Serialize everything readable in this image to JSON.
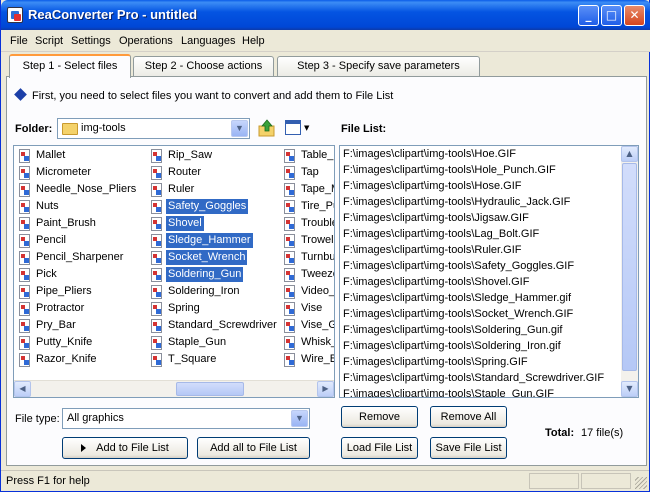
{
  "window": {
    "title": "ReaConverter Pro - untitled",
    "minimize": "_",
    "maximize": "□",
    "close": "✕"
  },
  "menu": [
    "File",
    "Script",
    "Settings",
    "Operations",
    "Languages",
    "Help"
  ],
  "tabs": [
    {
      "label": "Step 1 - Select files",
      "active": true
    },
    {
      "label": "Step 2 - Choose actions",
      "active": false
    },
    {
      "label": "Step 3 - Specify save parameters",
      "active": false
    }
  ],
  "hint": "First, you need to select files you want to convert and add them to File List",
  "folder": {
    "label": "Folder:",
    "value": "img-tools"
  },
  "file_list_label": "File List:",
  "files": {
    "col1": [
      "Mallet",
      "Micrometer",
      "Needle_Nose_Pliers",
      "Nuts",
      "Paint_Brush",
      "Pencil",
      "Pencil_Sharpener",
      "Pick",
      "Pipe_Pliers",
      "Protractor",
      "Pry_Bar",
      "Putty_Knife",
      "Razor_Knife"
    ],
    "col2": [
      "Rip_Saw",
      "Router",
      "Ruler",
      "Safety_Goggles",
      "Shovel",
      "Sledge_Hammer",
      "Socket_Wrench",
      "Soldering_Gun",
      "Soldering_Iron",
      "Spring",
      "Standard_Screwdriver",
      "Staple_Gun",
      "T_Square"
    ],
    "col3": [
      "Table_",
      "Tap",
      "Tape_M",
      "Tire_Pu",
      "Trouble",
      "Trowel",
      "Turnbu",
      "Tweeze",
      "Video_",
      "Vise",
      "Vise_G",
      "Whisk_",
      "Wire_B"
    ],
    "selected": [
      "Safety_Goggles",
      "Shovel",
      "Sledge_Hammer",
      "Socket_Wrench",
      "Soldering_Gun"
    ]
  },
  "file_list": [
    "F:\\images\\clipart\\img-tools\\Hoe.GIF",
    "F:\\images\\clipart\\img-tools\\Hole_Punch.GIF",
    "F:\\images\\clipart\\img-tools\\Hose.GIF",
    "F:\\images\\clipart\\img-tools\\Hydraulic_Jack.GIF",
    "F:\\images\\clipart\\img-tools\\Jigsaw.GIF",
    "F:\\images\\clipart\\img-tools\\Lag_Bolt.GIF",
    "F:\\images\\clipart\\img-tools\\Ruler.GIF",
    "F:\\images\\clipart\\img-tools\\Safety_Goggles.GIF",
    "F:\\images\\clipart\\img-tools\\Shovel.GIF",
    "F:\\images\\clipart\\img-tools\\Sledge_Hammer.gif",
    "F:\\images\\clipart\\img-tools\\Socket_Wrench.GIF",
    "F:\\images\\clipart\\img-tools\\Soldering_Gun.gif",
    "F:\\images\\clipart\\img-tools\\Soldering_Iron.gif",
    "F:\\images\\clipart\\img-tools\\Spring.GIF",
    "F:\\images\\clipart\\img-tools\\Standard_Screwdriver.GIF",
    "F:\\images\\clipart\\img-tools\\Staple_Gun.GIF"
  ],
  "file_type": {
    "label": "File type:",
    "value": "All graphics"
  },
  "buttons": {
    "add": "Add to File List",
    "add_all": "Add all to File List",
    "remove": "Remove",
    "remove_all": "Remove All",
    "load": "Load File List",
    "save": "Save File List"
  },
  "total": {
    "label": "Total:",
    "value": "17 file(s)"
  },
  "status": "Press F1 for help"
}
